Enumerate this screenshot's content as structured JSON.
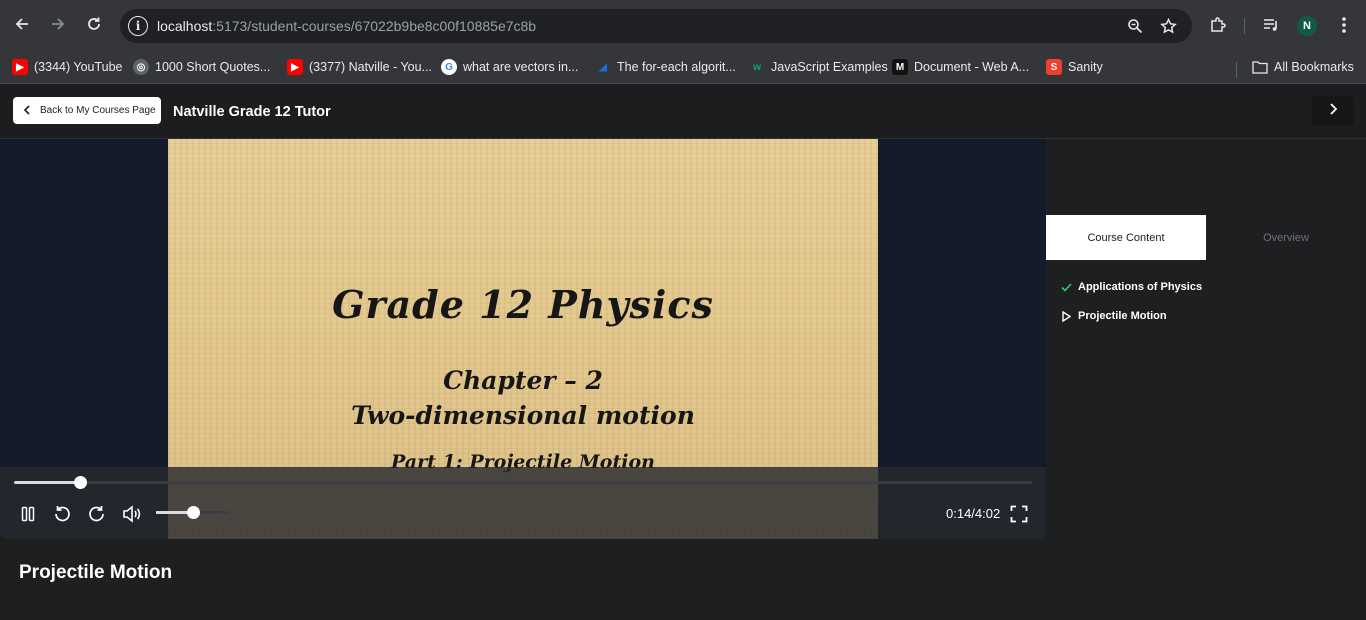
{
  "browser": {
    "url_host": "localhost",
    "url_path": ":5173/student-courses/67022b9be8c00f10885e7c8b",
    "avatar_letter": "N",
    "bookmarks": [
      {
        "label": "(3344) YouTube",
        "icon": "youtube-icon",
        "color": "#ff0000"
      },
      {
        "label": "1000 Short Quotes...",
        "icon": "globe-icon",
        "color": "#9aa0a6"
      },
      {
        "label": "(3377) Natville - You...",
        "icon": "youtube-icon",
        "color": "#ff0000"
      },
      {
        "label": "what are vectors in...",
        "icon": "google-icon",
        "color": "#4285f4"
      },
      {
        "label": "The for-each algorit...",
        "icon": "codecademy-icon",
        "color": "#1b6fd1"
      },
      {
        "label": "JavaScript Examples",
        "icon": "w3schools-icon",
        "color": "#04aa6d"
      },
      {
        "label": "Document - Web A...",
        "icon": "mdn-icon",
        "color": "#111111"
      },
      {
        "label": "Sanity",
        "icon": "sanity-icon",
        "color": "#f03e2f"
      }
    ],
    "all_bookmarks_label": "All Bookmarks"
  },
  "header": {
    "back_label": "Back to My Courses Page",
    "course_title": "Natville Grade 12 Tutor"
  },
  "video": {
    "slide_title": "Grade 12 Physics",
    "slide_chapter": "Chapter – 2",
    "slide_subtitle": "Two-dimensional motion",
    "slide_part": "Part 1: Projectile Motion",
    "time_display": "0:14/4:02",
    "progress_fraction": 0.065,
    "volume_fraction": 0.5
  },
  "lesson": {
    "title": "Projectile Motion"
  },
  "sidebar": {
    "tabs": [
      {
        "label": "Course Content",
        "active": true
      },
      {
        "label": "Overview",
        "active": false
      }
    ],
    "items": [
      {
        "label": "Applications of Physics",
        "status": "completed",
        "icon": "check-icon",
        "icon_color": "#2ecc71"
      },
      {
        "label": "Projectile Motion",
        "status": "playing",
        "icon": "play-outline-icon"
      }
    ]
  }
}
